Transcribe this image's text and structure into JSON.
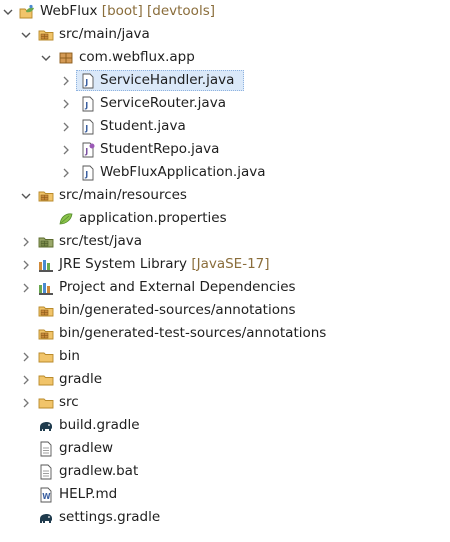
{
  "tree": {
    "project": {
      "name": "WebFlux",
      "decoration": "[boot] [devtools]"
    },
    "src_main_java": {
      "label": "src/main/java"
    },
    "package": {
      "label": "com.webflux.app"
    },
    "files": [
      {
        "label": "ServiceHandler.java"
      },
      {
        "label": "ServiceRouter.java"
      },
      {
        "label": "Student.java"
      },
      {
        "label": "StudentRepo.java"
      },
      {
        "label": "WebFluxApplication.java"
      }
    ],
    "src_main_resources": {
      "label": "src/main/resources"
    },
    "app_properties": {
      "label": "application.properties"
    },
    "src_test_java": {
      "label": "src/test/java"
    },
    "jre": {
      "label": "JRE System Library",
      "decoration": "[JavaSE-17]"
    },
    "deps": {
      "label": "Project and External Dependencies"
    },
    "gen_sources": {
      "label": "bin/generated-sources/annotations"
    },
    "gen_test_sources": {
      "label": "bin/generated-test-sources/annotations"
    },
    "bin": {
      "label": "bin"
    },
    "gradle": {
      "label": "gradle"
    },
    "src": {
      "label": "src"
    },
    "build_gradle": {
      "label": "build.gradle"
    },
    "gradlew": {
      "label": "gradlew"
    },
    "gradlew_bat": {
      "label": "gradlew.bat"
    },
    "help_md": {
      "label": "HELP.md"
    },
    "settings_gradle": {
      "label": "settings.gradle"
    }
  },
  "colors": {
    "selection": "#dbe9f9",
    "decoration_text": "#8a6d3b",
    "folder": "#e8b04b",
    "package": "#a0703a",
    "java_file": "#3a5fa0"
  },
  "icons": {
    "project": "gradle-project-icon",
    "source_folder": "source-folder-icon",
    "package": "package-icon",
    "java_file": "java-file-icon",
    "interface_file": "java-interface-file-icon",
    "properties": "spring-leaf-icon",
    "library": "library-icon",
    "folder": "folder-icon",
    "gradle": "gradle-elephant-icon",
    "text_file": "text-file-icon",
    "markdown": "markdown-file-icon"
  }
}
